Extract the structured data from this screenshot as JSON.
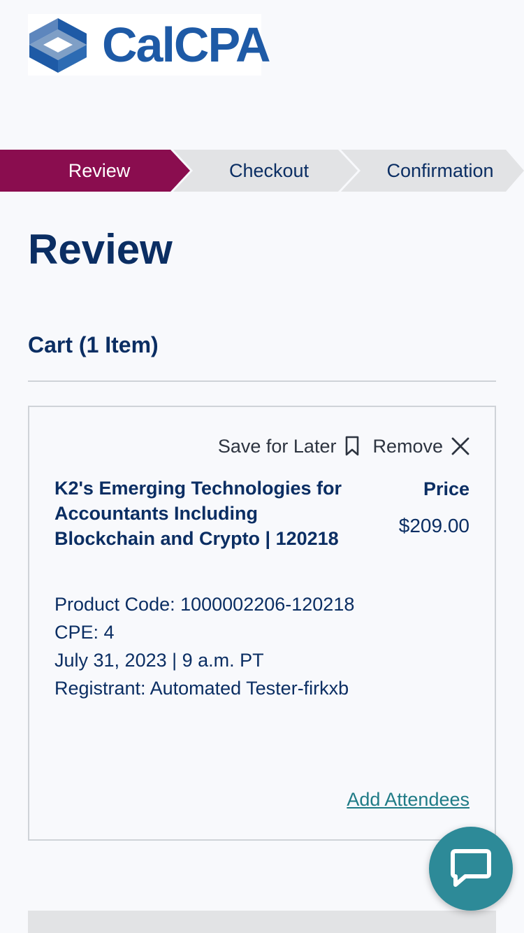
{
  "logo": {
    "text": "CalCPA",
    "icon": "calcpa-logo-icon"
  },
  "stepper": {
    "steps": [
      {
        "label": "Review",
        "active": true
      },
      {
        "label": "Checkout",
        "active": false
      },
      {
        "label": "Confirmation",
        "active": false
      }
    ],
    "active_color": "#8a0d4f",
    "inactive_color": "#e2e3e5"
  },
  "page_title": "Review",
  "cart": {
    "heading": "Cart (1 Item)",
    "items": [
      {
        "save_label": "Save for Later",
        "remove_label": "Remove",
        "title": "K2's Emerging Technologies for Accountants Including Blockchain and Crypto | 120218",
        "price_label": "Price",
        "price": "$209.00",
        "details": [
          "Product Code: 1000002206-120218",
          "CPE: 4",
          "July 31, 2023 | 9 a.m. PT",
          "Registrant: Automated Tester-firkxb"
        ],
        "add_attendees_label": "Add Attendees"
      }
    ]
  },
  "chat": {
    "icon": "chat-bubble-icon",
    "color": "#2d8a98"
  },
  "colors": {
    "primary_text": "#0b2e63",
    "link": "#1f7b86",
    "accent": "#8a0d4f"
  }
}
